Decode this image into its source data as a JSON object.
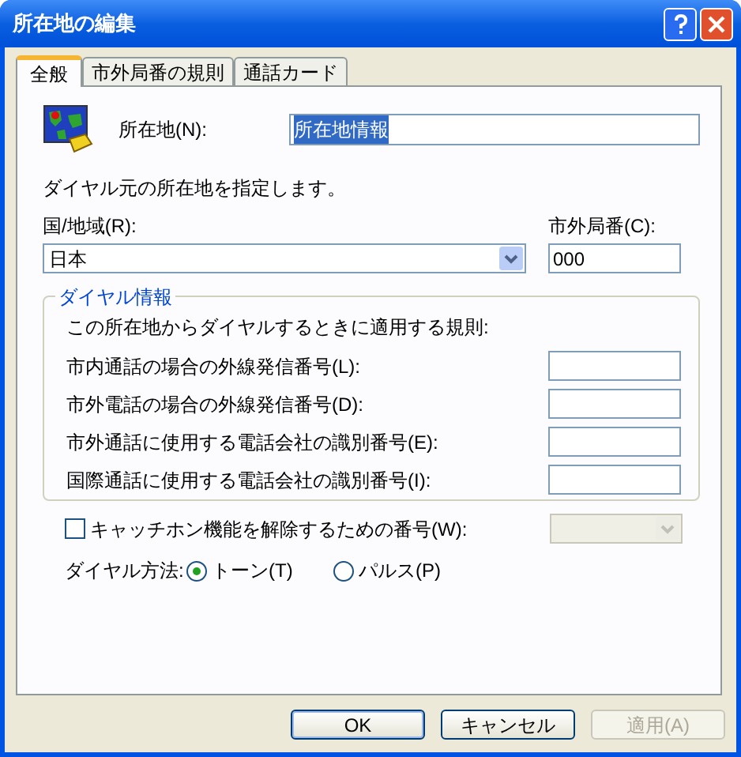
{
  "window": {
    "title": "所在地の編集"
  },
  "tabs": [
    {
      "label": "全般",
      "selected": true
    },
    {
      "label": "市外局番の規則",
      "selected": false
    },
    {
      "label": "通話カード",
      "selected": false
    }
  ],
  "location": {
    "label": "所在地(N):",
    "value": "所在地情報",
    "text_selected": true
  },
  "description": "ダイヤル元の所在地を指定します。",
  "country": {
    "label": "国/地域(R):",
    "value": "日本"
  },
  "area_code": {
    "label": "市外局番(C):",
    "value": "000"
  },
  "dialing_rules": {
    "title": "ダイヤル情報",
    "description": "この所在地からダイヤルするときに適用する規則:",
    "fields": [
      {
        "label": "市内通話の場合の外線発信番号(L):"
      },
      {
        "label": "市外電話の場合の外線発信番号(D):"
      },
      {
        "label": "市外通話に使用する電話会社の識別番号(E):"
      },
      {
        "label": "国際通話に使用する電話会社の識別番号(I):"
      }
    ]
  },
  "call_waiting": {
    "label": "キャッチホン機能を解除するための番号(W):",
    "checked": false,
    "dropdown_disabled": true
  },
  "dial_method": {
    "label": "ダイヤル方法:",
    "options": [
      {
        "label": "トーン(T)",
        "selected": true
      },
      {
        "label": "パルス(P)",
        "selected": false
      }
    ]
  },
  "buttons": [
    {
      "label": "OK",
      "disabled": false,
      "default": true
    },
    {
      "label": "キャンセル",
      "disabled": false,
      "default": false
    },
    {
      "label": "適用(A)",
      "disabled": true,
      "default": false
    }
  ]
}
